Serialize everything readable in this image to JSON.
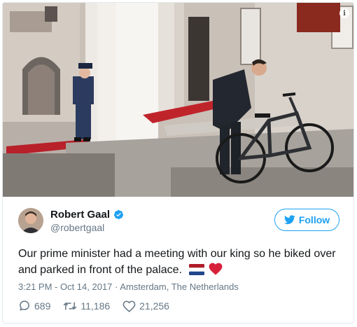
{
  "tweet": {
    "author": {
      "display_name": "Robert Gaal",
      "handle": "@robertgaal",
      "verified": true
    },
    "follow_label": "Follow",
    "text": "Our prime minister had a meeting with our king so he biked over and parked in front of the palace.",
    "emoji": [
      "netherlands-flag",
      "red-heart"
    ],
    "time": "3:21 PM - Oct 14, 2017",
    "separator": "·",
    "location": "Amsterdam, The Netherlands",
    "counts": {
      "replies": "689",
      "retweets": "11,186",
      "likes": "21,256"
    },
    "icons": [
      "info-icon",
      "verified-badge-icon",
      "twitter-bird-icon",
      "reply-icon",
      "retweet-icon",
      "like-icon"
    ],
    "colors": {
      "accent": "#1da1f2",
      "muted": "#657786",
      "text": "#14171a",
      "border": "#e1e8ed"
    }
  }
}
